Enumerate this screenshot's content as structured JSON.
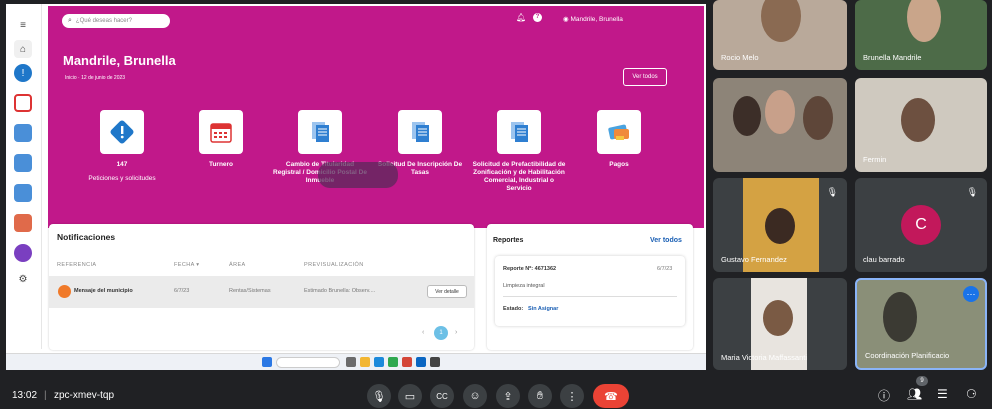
{
  "app": {
    "search_placeholder": "¿Qué deseas hacer?",
    "user_name": "Mandrile, Brunella",
    "header_title": "Mandrile, Brunella",
    "breadcrumb": "Inicio · 12 de junio de 2023",
    "ver_todos": "Ver todos"
  },
  "tiles": [
    {
      "icon": "alert-icon",
      "label": "",
      "count": "147",
      "sublabel": "Peticiones y solicitudes"
    },
    {
      "icon": "calendar-icon",
      "label": "Turnero"
    },
    {
      "icon": "document-icon",
      "label": "Cambio de Titularidad Registral / Domicilio Postal De Inmueble"
    },
    {
      "icon": "document-icon",
      "label": "Solicitud De Inscripción De Tasas"
    },
    {
      "icon": "document-icon",
      "label": "Solicitud de Prefactibilidad de Zonificación y de Habilitación Comercial, Industrial o Servicio"
    },
    {
      "icon": "payment-card-icon",
      "label": "Pagos"
    }
  ],
  "notificaciones": {
    "title": "Notificaciones",
    "headers": [
      "REFERENCIA",
      "FECHA ▾",
      "ÁREA",
      "PREVISUALIZACIÓN"
    ],
    "row": {
      "referencia": "Mensaje del municipio",
      "fecha": "6/7/23",
      "area": "Rentas/Sistemas",
      "preview": "Estimado Brunella: Observ....",
      "action": "Ver detalle"
    },
    "page": "1"
  },
  "reportes": {
    "title": "Reportes",
    "link": "Ver todos",
    "numero": "Reporte Nº: 4671362",
    "fecha": "6/7/23",
    "tipo": "Limpieza integral",
    "estado_label": "Estado:",
    "estado_value": "Sin Asignar"
  },
  "participants": [
    {
      "name": "Rocio Melo",
      "muted": false
    },
    {
      "name": "Brunella Mandrile",
      "muted": false
    },
    {
      "name": "",
      "muted": false
    },
    {
      "name": "Fermin",
      "muted": false
    },
    {
      "name": "Gustavo Fernandez",
      "muted": true
    },
    {
      "name": "clau barrado",
      "muted": true,
      "avatar_letter": "C"
    },
    {
      "name": "Maria Victoria Maffassanti",
      "muted": false
    },
    {
      "name": "Coordinación Planificacio",
      "muted": false
    }
  ],
  "meeting": {
    "time": "13:02",
    "code": "zpc-xmev-tqp",
    "participant_count": "9"
  },
  "colors": {
    "brand": "#c1188a",
    "end_call": "#ea4335",
    "link": "#1a5fb4"
  }
}
